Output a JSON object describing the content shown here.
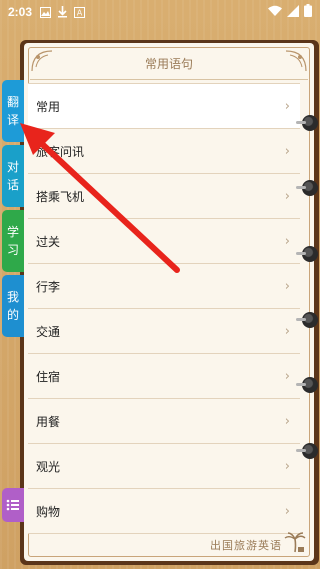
{
  "status_bar": {
    "time": "2:03",
    "left_icons": [
      "image-icon",
      "download-icon",
      "app-a-icon"
    ],
    "right_icons": [
      "wifi-icon",
      "signal-icon",
      "battery-icon"
    ]
  },
  "page": {
    "title": "常用语句",
    "items": [
      {
        "label": "常用"
      },
      {
        "label": "旅客问讯"
      },
      {
        "label": "搭乘飞机"
      },
      {
        "label": "过关"
      },
      {
        "label": "行李"
      },
      {
        "label": "交通"
      },
      {
        "label": "住宿"
      },
      {
        "label": "用餐"
      },
      {
        "label": "观光"
      },
      {
        "label": "购物"
      }
    ],
    "chevron": "›",
    "footer_text": "出国旅游英语"
  },
  "tabs": [
    {
      "c1": "翻",
      "c2": "译",
      "color": "#1e9bd7"
    },
    {
      "c1": "对",
      "c2": "话",
      "color": "#1aa0c9"
    },
    {
      "c1": "学",
      "c2": "习",
      "color": "#2fa94a"
    },
    {
      "c1": "我",
      "c2": "的",
      "color": "#1e8fd0"
    }
  ],
  "menu_tab": {
    "icon": "list-icon",
    "color": "#b05fc8"
  },
  "colors": {
    "annotation_arrow": "#e8241c"
  }
}
